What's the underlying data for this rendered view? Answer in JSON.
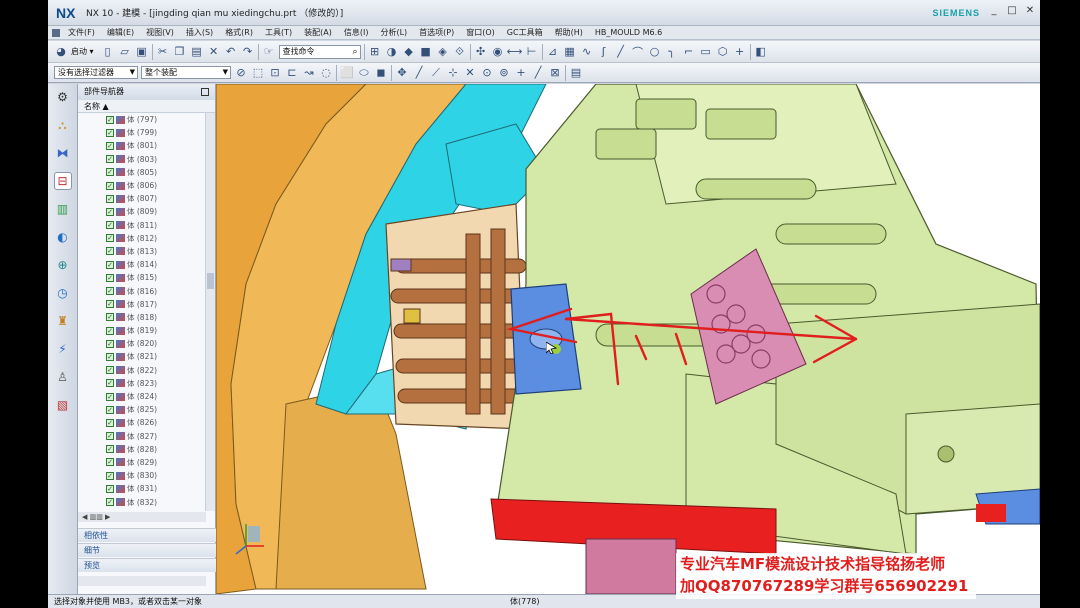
{
  "app": {
    "logo": "NX",
    "title": "NX 10 - 建模 - [jingding qian mu xiedingchu.prt （修改的）]",
    "brand": "SIEMENS"
  },
  "menu": [
    "文件(F)",
    "编辑(E)",
    "视图(V)",
    "插入(S)",
    "格式(R)",
    "工具(T)",
    "装配(A)",
    "信息(I)",
    "分析(L)",
    "首选项(P)",
    "窗口(O)",
    "GC工具箱",
    "帮助(H)",
    "HB_MOULD M6.6"
  ],
  "toolbar": {
    "start_label": "启动 ▾",
    "search_placeholder": "查找命令"
  },
  "selection": {
    "filter": "没有选择过滤器",
    "scope": "整个装配"
  },
  "navigator": {
    "title": "部件导航器",
    "column_name": "名称",
    "items": [
      "体 (797)",
      "体 (799)",
      "体 (801)",
      "体 (803)",
      "体 (805)",
      "体 (806)",
      "体 (807)",
      "体 (809)",
      "体 (811)",
      "体 (812)",
      "体 (813)",
      "体 (814)",
      "体 (815)",
      "体 (816)",
      "体 (817)",
      "体 (818)",
      "体 (819)",
      "体 (820)",
      "体 (821)",
      "体 (822)",
      "体 (823)",
      "体 (824)",
      "体 (825)",
      "体 (826)",
      "体 (827)",
      "体 (828)",
      "体 (829)",
      "体 (830)",
      "体 (831)",
      "体 (832)"
    ],
    "panels": [
      "相依性",
      "细节",
      "预览"
    ]
  },
  "status": {
    "prompt": "选择对象并使用 MB3，或者双击某一对象",
    "selection": "体(778)"
  },
  "watermark": {
    "line1": "专业汽车MF模流设计技术指导铭扬老师",
    "line2": "加QQ870767289学习群号656902291"
  },
  "colors": {
    "part_green": "#d4e8a8",
    "mould_cyan": "#2fd3e6",
    "mould_orange": "#e8a43a",
    "pin_brown": "#b4703f",
    "slider_blue": "#5b8ee0",
    "pink_plate": "#d98db3",
    "red_plate": "#e82020",
    "annotation_red": "#e01e1e"
  }
}
